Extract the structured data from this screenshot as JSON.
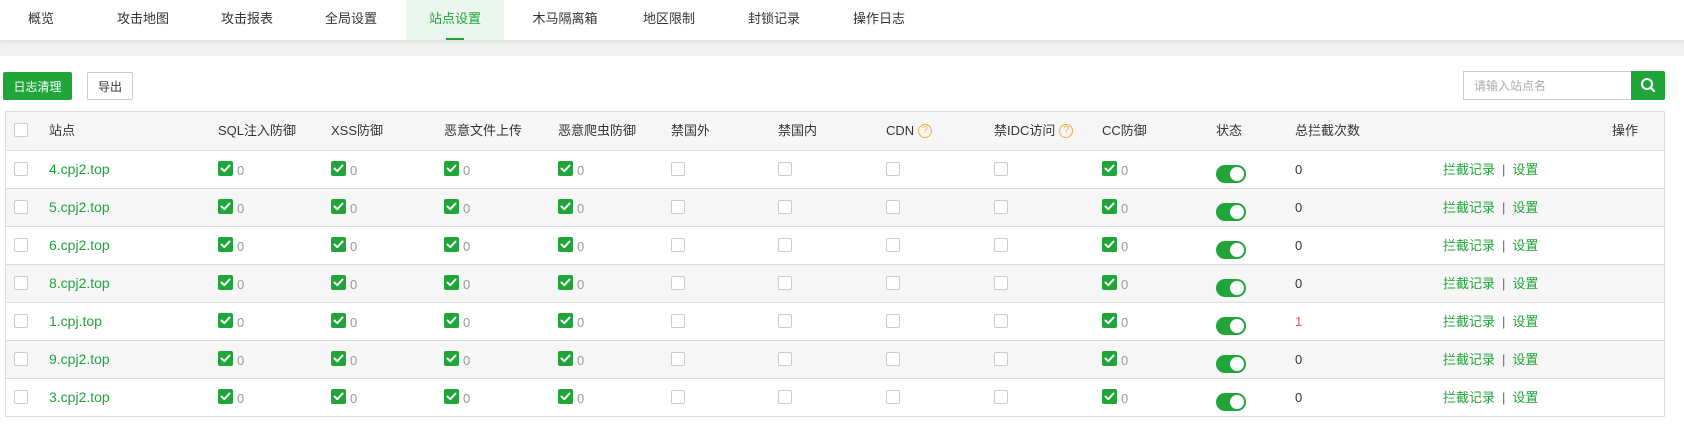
{
  "tabs": [
    "概览",
    "攻击地图",
    "攻击报表",
    "全局设置",
    "站点设置",
    "木马隔离箱",
    "地区限制",
    "封锁记录",
    "操作日志"
  ],
  "toolbar": {
    "clear_log_label": "日志清理",
    "export_label": "导出",
    "search_placeholder": "请输入站点名"
  },
  "table": {
    "headers": {
      "site": "站点",
      "sql": "SQL注入防御",
      "xss": "XSS防御",
      "upload": "恶意文件上传",
      "crawler": "恶意爬虫防御",
      "ban_abroad": "禁国外",
      "ban_domestic": "禁国内",
      "cdn": "CDN",
      "idc": "禁IDC访问",
      "cc": "CC防御",
      "status": "状态",
      "total": "总拦截次数",
      "actions": "操作"
    },
    "rows": [
      {
        "site": "4.cpj2.top",
        "sql": "0",
        "xss": "0",
        "upload": "0",
        "crawler": "0",
        "cc": "0",
        "total": "0"
      },
      {
        "site": "5.cpj2.top",
        "sql": "0",
        "xss": "0",
        "upload": "0",
        "crawler": "0",
        "cc": "0",
        "total": "0"
      },
      {
        "site": "6.cpj2.top",
        "sql": "0",
        "xss": "0",
        "upload": "0",
        "crawler": "0",
        "cc": "0",
        "total": "0"
      },
      {
        "site": "8.cpj2.top",
        "sql": "0",
        "xss": "0",
        "upload": "0",
        "crawler": "0",
        "cc": "0",
        "total": "0"
      },
      {
        "site": "1.cpj.top",
        "sql": "0",
        "xss": "0",
        "upload": "0",
        "crawler": "0",
        "cc": "0",
        "total": "1"
      },
      {
        "site": "9.cpj2.top",
        "sql": "0",
        "xss": "0",
        "upload": "0",
        "crawler": "0",
        "cc": "0",
        "total": "0"
      },
      {
        "site": "3.cpj2.top",
        "sql": "0",
        "xss": "0",
        "upload": "0",
        "crawler": "0",
        "cc": "0",
        "total": "0"
      }
    ],
    "actions": {
      "log_label": "拦截记录",
      "separator": "|",
      "settings_label": "设置"
    }
  },
  "colors": {
    "accent": "#20a53a",
    "danger_count": "#d9534f",
    "help_icon": "#f0ad4e"
  }
}
